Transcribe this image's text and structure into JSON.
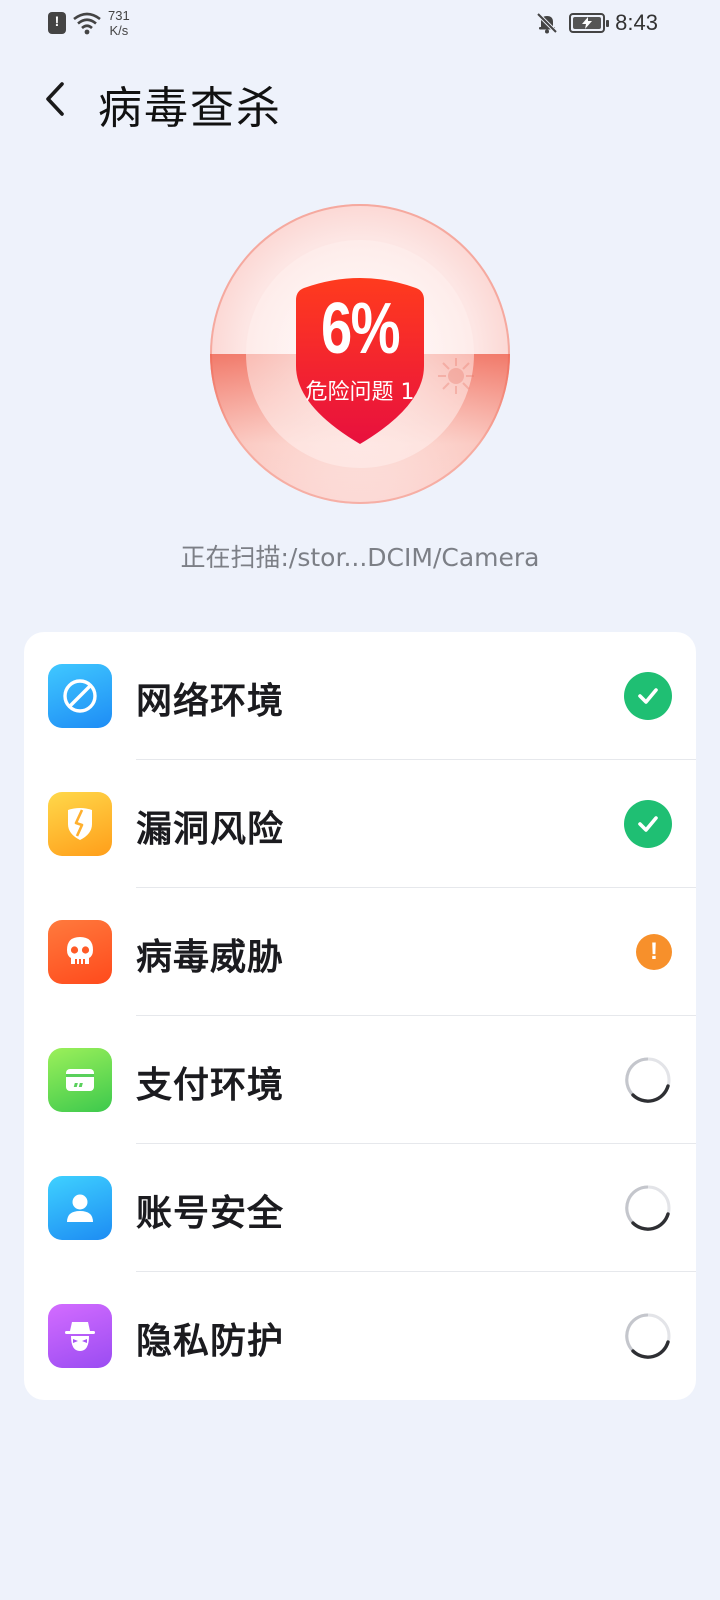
{
  "status_bar": {
    "net_speed_value": "731",
    "net_speed_unit": "K/s",
    "time": "8:43"
  },
  "header": {
    "title": "病毒查杀"
  },
  "scan": {
    "percent": "6%",
    "risk_label": "危险问题 1",
    "progress_fraction": 0.06,
    "path_text": "正在扫描:/stor...DCIM/Camera"
  },
  "items": [
    {
      "label": "网络环境",
      "icon": "network-icon",
      "status": "done"
    },
    {
      "label": "漏洞风险",
      "icon": "vulnerability-shield-icon",
      "status": "done"
    },
    {
      "label": "病毒威胁",
      "icon": "skull-icon",
      "status": "warning"
    },
    {
      "label": "支付环境",
      "icon": "payment-card-icon",
      "status": "loading"
    },
    {
      "label": "账号安全",
      "icon": "account-user-icon",
      "status": "loading"
    },
    {
      "label": "隐私防护",
      "icon": "privacy-spy-icon",
      "status": "loading"
    }
  ],
  "colors": {
    "accent_red": "#e8413a",
    "ok_green": "#1fbf73",
    "warn_orange": "#f7902b",
    "background": "#eef2fb"
  }
}
